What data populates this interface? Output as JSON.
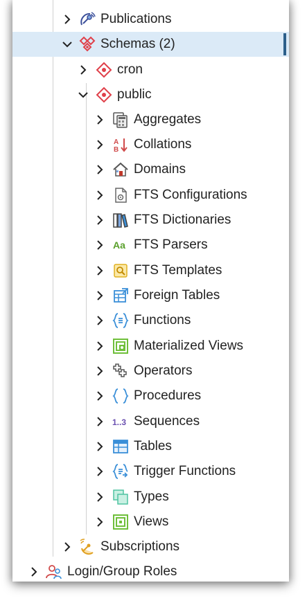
{
  "tree": {
    "publications": "Publications",
    "schemas": "Schemas (2)",
    "cron": "cron",
    "public": "public",
    "items": [
      "Aggregates",
      "Collations",
      "Domains",
      "FTS Configurations",
      "FTS Dictionaries",
      "FTS Parsers",
      "FTS Templates",
      "Foreign Tables",
      "Functions",
      "Materialized Views",
      "Operators",
      "Procedures",
      "Sequences",
      "Tables",
      "Trigger Functions",
      "Types",
      "Views"
    ],
    "subscriptions": "Subscriptions",
    "login_roles": "Login/Group Roles"
  },
  "icon_glyphs": {
    "collations": "A B",
    "fts_parsers": "Aa",
    "sequences": "1..3"
  },
  "colors": {
    "selected_bg": "#dbeaf7",
    "selected_bar": "#2c5f8a",
    "schema_red": "#e0404a",
    "function_blue": "#3a8fd8",
    "view_green": "#6fbf3a",
    "sequence_purple": "#6a4fb0"
  }
}
